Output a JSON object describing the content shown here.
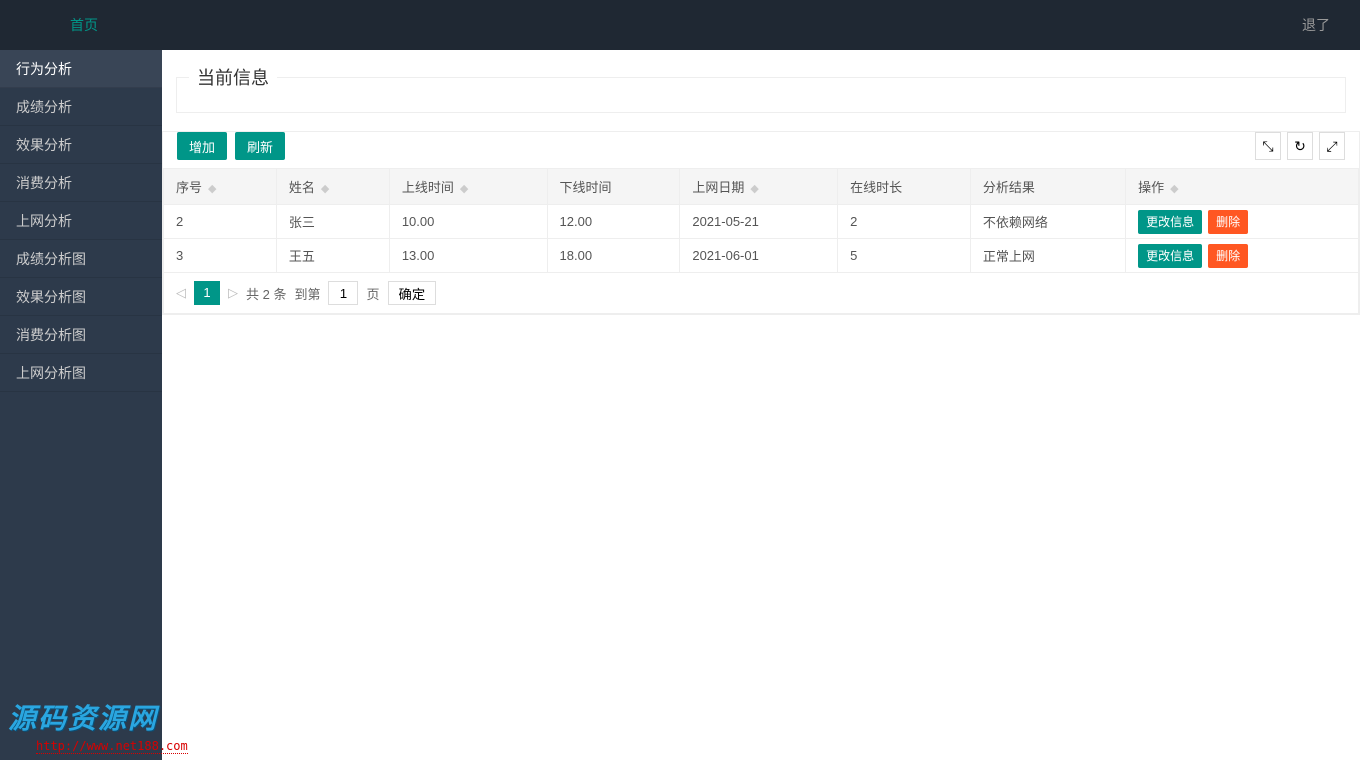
{
  "header": {
    "home": "首页",
    "logout": "退了"
  },
  "sidebar": {
    "items": [
      {
        "label": "行为分析",
        "active": true
      },
      {
        "label": "成绩分析",
        "active": false
      },
      {
        "label": "效果分析",
        "active": false
      },
      {
        "label": "消费分析",
        "active": false
      },
      {
        "label": "上网分析",
        "active": false
      },
      {
        "label": "成绩分析图",
        "active": false
      },
      {
        "label": "效果分析图",
        "active": false
      },
      {
        "label": "消费分析图",
        "active": false
      },
      {
        "label": "上网分析图",
        "active": false
      }
    ]
  },
  "main": {
    "fieldset_title": "当前信息",
    "toolbar": {
      "add_label": "增加",
      "refresh_label": "刷新",
      "tool1": "⤡",
      "tool2": "↻",
      "tool3": "⤢"
    },
    "columns": {
      "seq": {
        "label": "序号",
        "sortable": true
      },
      "name": {
        "label": "姓名",
        "sortable": true
      },
      "online_time": {
        "label": "上线时间",
        "sortable": true
      },
      "offline_time": {
        "label": "下线时间",
        "sortable": false
      },
      "online_date": {
        "label": "上网日期",
        "sortable": true
      },
      "duration": {
        "label": "在线时长",
        "sortable": false
      },
      "result": {
        "label": "分析结果",
        "sortable": false
      },
      "ops": {
        "label": "操作",
        "sortable": true
      }
    },
    "rows": [
      {
        "seq": "2",
        "name": "张三",
        "online_time": "10.00",
        "offline_time": "12.00",
        "online_date": "2021-05-21",
        "duration": "2",
        "result": "不依赖网络"
      },
      {
        "seq": "3",
        "name": "王五",
        "online_time": "13.00",
        "offline_time": "18.00",
        "online_date": "2021-06-01",
        "duration": "5",
        "result": "正常上网"
      }
    ],
    "row_ops": {
      "edit_label": "更改信息",
      "delete_label": "删除"
    },
    "pagination": {
      "current": "1",
      "total_text": "共 2 条",
      "goto_prefix": "到第",
      "goto_value": "1",
      "goto_suffix": "页",
      "confirm_label": "确定"
    }
  },
  "watermark": {
    "title": "源码资源网",
    "url": "http://www.net188.com"
  }
}
